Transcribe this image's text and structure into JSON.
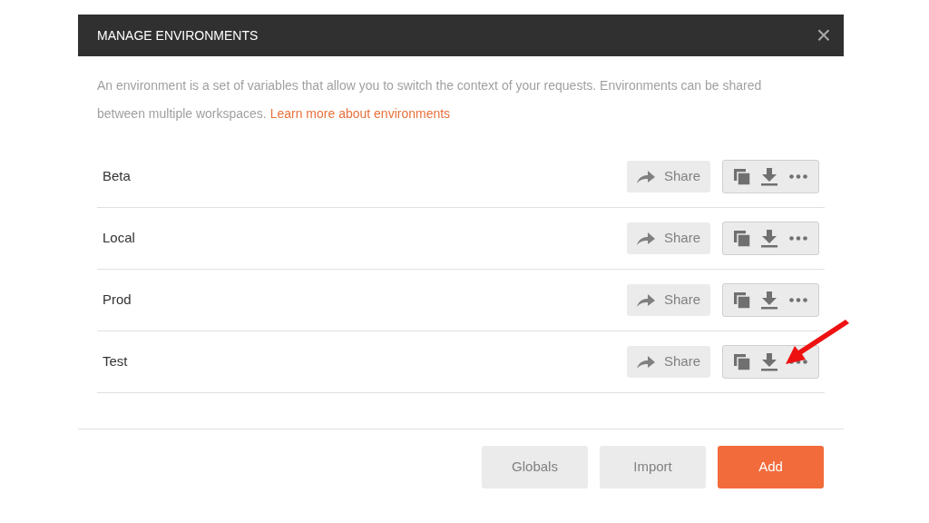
{
  "dialog": {
    "title": "MANAGE ENVIRONMENTS",
    "close": "×"
  },
  "description": {
    "text": "An environment is a set of variables that allow you to switch the context of your requests. Environments can be shared between multiple workspaces.",
    "link": "Learn more about environments"
  },
  "environments": [
    {
      "name": "Beta",
      "share": "Share"
    },
    {
      "name": "Local",
      "share": "Share"
    },
    {
      "name": "Prod",
      "share": "Share"
    },
    {
      "name": "Test",
      "share": "Share"
    }
  ],
  "footer_buttons": [
    {
      "label": "Globals",
      "kind": "secondary"
    },
    {
      "label": "Import",
      "kind": "secondary"
    },
    {
      "label": "Add",
      "kind": "primary"
    }
  ]
}
